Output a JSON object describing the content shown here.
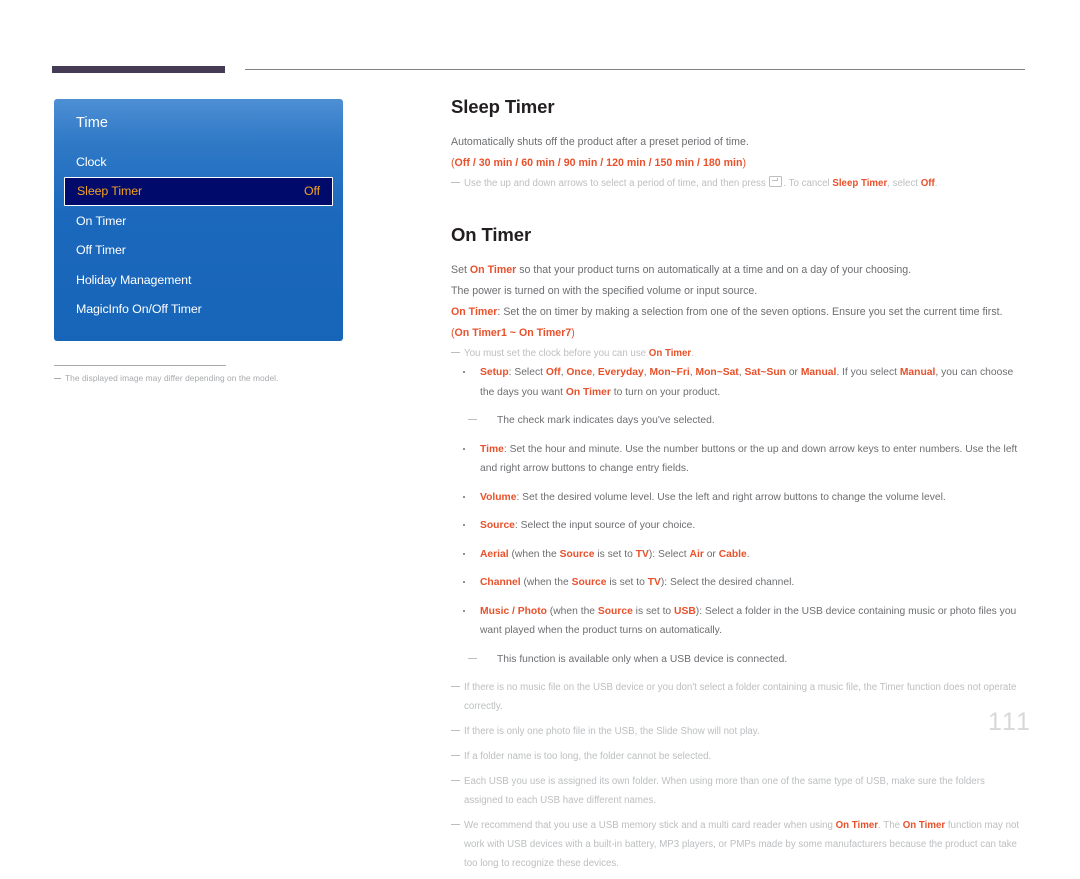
{
  "page": {
    "number": "111",
    "footnote_left": "The displayed image may differ depending on the model."
  },
  "osd": {
    "title": "Time",
    "items": [
      {
        "label": "Clock",
        "value": "",
        "selected": false
      },
      {
        "label": "Sleep Timer",
        "value": "Off",
        "selected": true
      },
      {
        "label": "On Timer",
        "value": "",
        "selected": false
      },
      {
        "label": "Off Timer",
        "value": "",
        "selected": false
      },
      {
        "label": "Holiday Management",
        "value": "",
        "selected": false
      },
      {
        "label": "MagicInfo On/Off Timer",
        "value": "",
        "selected": false
      }
    ]
  },
  "sleep_timer": {
    "heading": "Sleep Timer",
    "intro": "Automatically shuts off the product after a preset period of time.",
    "options_open": "(",
    "options": "Off / 30 min / 60 min / 90 min / 120 min / 150 min / 180 min",
    "options_close": ")",
    "note_a": "Use the up and down arrows to select a period of time, and then press ",
    "note_b": ". To cancel ",
    "note_term": "Sleep Timer",
    "note_c": ", select ",
    "note_off": "Off",
    "note_d": "."
  },
  "on_timer": {
    "heading": "On Timer",
    "p1_a": "Set ",
    "p1_term": "On Timer",
    "p1_b": " so that your product turns on automatically at a time and on a day of your choosing.",
    "p2": "The power is turned on with the specified volume or input source.",
    "p3_term": "On Timer",
    "p3_b": ": Set the on timer by making a selection from one of the seven options. Ensure you set the current time first.",
    "p4_open": "(",
    "p4_range": "On Timer1 ~ On Timer7",
    "p4_close": ")",
    "note1_a": "You must set the clock before you can use ",
    "note1_term": "On Timer",
    "note1_b": ".",
    "bullets": [
      {
        "term": "Setup",
        "text_a": ": Select ",
        "opts": [
          "Off",
          "Once",
          "Everyday",
          "Mon~Fri",
          "Mon~Sat",
          "Sat~Sun"
        ],
        "text_or": " or ",
        "opt_manual": "Manual",
        "text_b": ". If you select ",
        "opt_manual2": "Manual",
        "text_c": ", you can choose the days you want ",
        "term2": "On Timer",
        "text_d": " to turn on your product.",
        "subnote": "The check mark indicates days you've selected."
      },
      {
        "term": "Time",
        "text": ": Set the hour and minute. Use the number buttons or the up and down arrow keys to enter numbers. Use the left and right arrow buttons to change entry fields."
      },
      {
        "term": "Volume",
        "text": ": Set the desired volume level. Use the left and right arrow buttons to change the volume level."
      },
      {
        "term": "Source",
        "text": ": Select the input source of your choice."
      },
      {
        "term": "Aerial",
        "text_a": " (when the ",
        "term_source": "Source",
        "text_b": " is set to ",
        "term_tv": "TV",
        "text_c": "): Select ",
        "opt_air": "Air",
        "text_or": " or ",
        "opt_cable": "Cable",
        "text_d": "."
      },
      {
        "term": "Channel",
        "text_a": " (when the ",
        "term_source": "Source",
        "text_b": " is set to ",
        "term_tv": "TV",
        "text_c": "): Select the desired channel."
      },
      {
        "term": "Music / Photo",
        "text_a": " (when the ",
        "term_source": "Source",
        "text_b": " is set to ",
        "term_usb": "USB",
        "text_c": "): Select a folder in the USB device containing music or photo files you want played when the product turns on automatically.",
        "subnote": "This function is available only when a USB device is connected."
      }
    ],
    "tail_notes": [
      {
        "text": "If there is no music file on the USB device or you don't select a folder containing a music file, the Timer function does not operate correctly."
      },
      {
        "text": "If there is only one photo file in the USB, the Slide Show will not play."
      },
      {
        "text": "If a folder name is too long, the folder cannot be selected."
      },
      {
        "text": "Each USB you use is assigned its own folder. When using more than one of the same type of USB, make sure the folders assigned to each USB have different names."
      }
    ],
    "final_note": {
      "a": "We recommend that you use a USB memory stick and a multi card reader when using ",
      "term1": "On Timer",
      "b": ". The ",
      "term2": "On Timer",
      "c": " function may not work with USB devices with a built-in battery, MP3 players, or PMPs made by some manufacturers because the product can take too long to recognize these devices."
    }
  },
  "colors": {
    "accent_red": "#e8512b",
    "osd_blue": "#1b68bd",
    "osd_selected_bg": "#000a6b",
    "osd_selected_text": "#f5a11e",
    "top_bar": "#453b55"
  }
}
